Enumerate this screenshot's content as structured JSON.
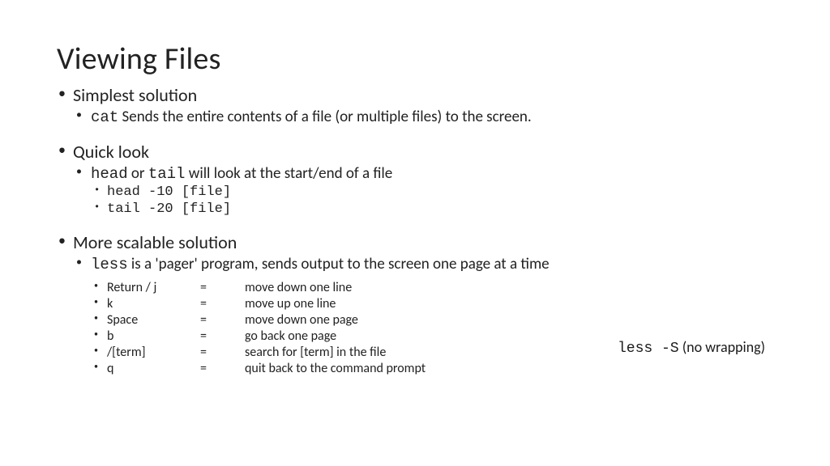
{
  "title": "Viewing Files",
  "sections": [
    {
      "heading": "Simplest solution",
      "sub": {
        "cmd": "cat",
        "text": " Sends the entire contents of a file (or multiple files) to the screen."
      }
    },
    {
      "heading": "Quick look",
      "sub": {
        "cmd1": "head",
        "mid": " or ",
        "cmd2": "tail",
        "text": " will look at the start/end of a file"
      },
      "examples": [
        "head -10 [file]",
        "tail -20 [file]"
      ]
    },
    {
      "heading": "More scalable solution",
      "sub": {
        "cmd": "less",
        "text": " is a 'pager' program, sends output to the screen one page at a time"
      },
      "keys": [
        {
          "key": "Return / j",
          "eq": "=",
          "desc": "move down one line"
        },
        {
          "key": "k",
          "eq": "=",
          "desc": "move up one line"
        },
        {
          "key": "Space",
          "eq": "=",
          "desc": "move down one page"
        },
        {
          "key": "b",
          "eq": "=",
          "desc": "go back one page"
        },
        {
          "key": "/[term]",
          "eq": "=",
          "desc": "search for [term] in the file"
        },
        {
          "key": "q",
          "eq": "=",
          "desc": "quit back to the command prompt"
        }
      ]
    }
  ],
  "side_note": {
    "cmd": "less -S",
    "text": "  (no wrapping)"
  }
}
